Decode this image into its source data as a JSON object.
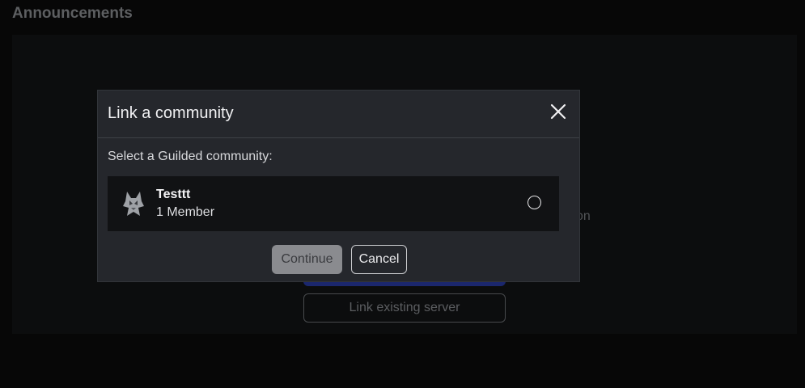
{
  "page": {
    "heading": "Announcements"
  },
  "background": {
    "partial_text": "on",
    "link_existing_label": "Link existing server",
    "illustration_icon": "megaphone-icon"
  },
  "modal": {
    "title": "Link a community",
    "close_icon": "close-icon",
    "select_label": "Select a Guilded community:",
    "communities": [
      {
        "name": "Testtt",
        "members": "1 Member",
        "avatar_icon": "wolf-avatar-icon",
        "selected": false
      }
    ],
    "continue_label": "Continue",
    "cancel_label": "Cancel"
  },
  "colors": {
    "background": "#0b0b0c",
    "panel": "#131416",
    "modal": "#25272c",
    "row": "#111214",
    "continue_disabled": "#8a8b8f",
    "primary_blue": "#2a3da8"
  }
}
